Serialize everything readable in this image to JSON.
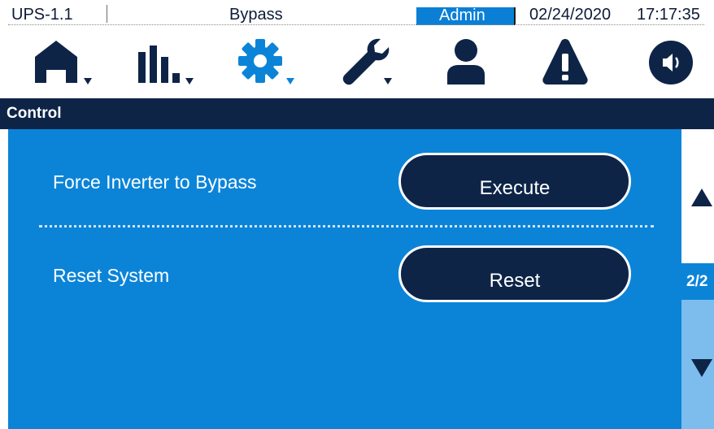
{
  "status_bar": {
    "device_name": "UPS-1.1",
    "mode": "Bypass",
    "user": "Admin",
    "date": "02/24/2020",
    "time": "17:17:35"
  },
  "toolbar": {
    "icons": [
      "home-icon",
      "bar-chart-icon",
      "gear-icon",
      "wrench-icon",
      "user-icon",
      "warning-icon",
      "speaker-icon"
    ],
    "active_icon": "gear-icon",
    "colors": {
      "default": "#0e2447",
      "active": "#0b84d8"
    }
  },
  "section": {
    "title": "Control"
  },
  "controls": [
    {
      "label": "Force Inverter to Bypass",
      "button": "Execute"
    },
    {
      "label": "Reset System",
      "button": "Reset"
    }
  ],
  "pager": {
    "page": "2/2"
  },
  "colors": {
    "panel": "#0b84d8",
    "header": "#0e2447",
    "button": "#0e2447",
    "scroll_down_bg": "#7cbdee"
  }
}
